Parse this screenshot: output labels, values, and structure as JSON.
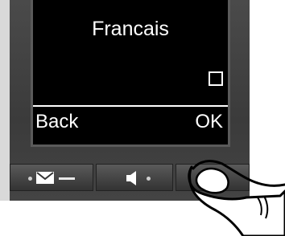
{
  "display": {
    "title": "Francais",
    "softkey_left": "Back",
    "softkey_right": "OK"
  },
  "keys": [
    {
      "icon": "message-envelope-icon"
    },
    {
      "icon": "speaker-volume-icon"
    },
    {
      "icon": "blank-key"
    }
  ],
  "colors": {
    "screen_bg": "#000000",
    "screen_text": "#ffffff",
    "phone_body": "#3b3b3b"
  }
}
